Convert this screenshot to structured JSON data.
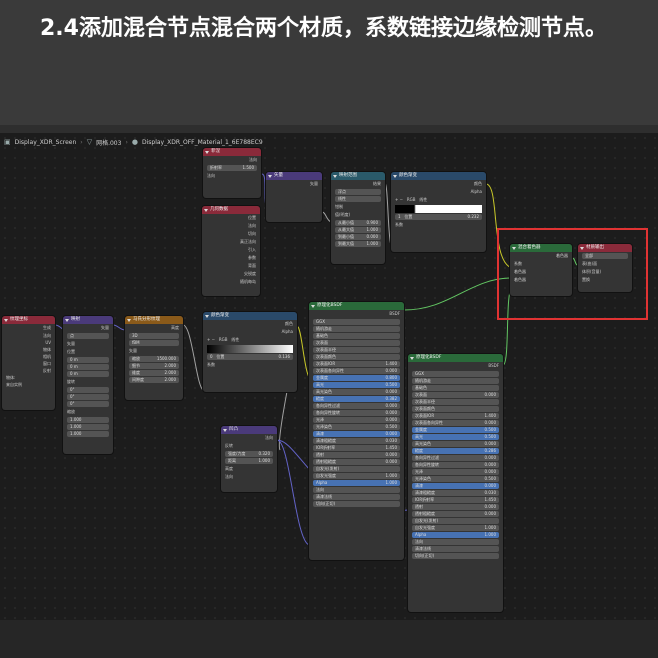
{
  "title": "2.4添加混合节点混合两个材质，系数链接边缘检测节点。",
  "breadcrumb": {
    "screen": "Display_XDR_Screen",
    "mesh": "网格.003",
    "material": "Display_XDR_OFF_Material_1_6E788EC9"
  },
  "nodes": {
    "texcoord": {
      "title": "纹理坐标",
      "rows": [
        "生成",
        "法向",
        "UV",
        "物体",
        "相机",
        "窗口",
        "反射"
      ],
      "object_label": "物体:",
      "from_instancer": "来自实例"
    },
    "mapping": {
      "title": "映射",
      "vector": "矢量",
      "type_label": "类型:",
      "type_value": "点",
      "vec_label": "矢量",
      "location": "位置",
      "rotation": "旋转",
      "scale": "缩放",
      "x": "X",
      "y": "Y",
      "z": "Z",
      "loc_vals": [
        "0 m",
        "0 m",
        "0 m"
      ],
      "rot_vals": [
        "0°",
        "0°",
        "0°"
      ],
      "scale_vals": [
        "1.000",
        "1.000",
        "1.000"
      ]
    },
    "musgrave": {
      "title": "马氏分形纹理",
      "height": "高度",
      "dim": "3D",
      "type": "fBM",
      "vec": "矢量",
      "rows": [
        [
          "缩放",
          "1500.000"
        ],
        [
          "细节",
          "2.000"
        ],
        [
          "维度",
          "2.000"
        ],
        [
          "间隙度",
          "2.000"
        ]
      ]
    },
    "colorramp1": {
      "title": "颜色渐变",
      "color": "颜色",
      "alpha": "Alpha",
      "mode": "RGB",
      "interp": "线性",
      "index": "0",
      "pos_label": "位置",
      "pos": "0.136",
      "fac": "系数"
    },
    "bump": {
      "title": "凹凸",
      "normal": "法向",
      "invert": "反转",
      "rows": [
        [
          "强度/力度",
          "0.320"
        ],
        [
          "距离",
          "1.000"
        ]
      ],
      "height": "高度",
      "normal_in": "法向"
    },
    "geometry_small": {
      "title": "菲涅",
      "out": "法向",
      "fields": [
        "折射率",
        "1.500"
      ],
      "normal": "法向"
    },
    "vector": {
      "title": "矢量",
      "out": "矢量"
    },
    "layer_weight": {
      "title": "几何数据",
      "rows": [
        "位置",
        "法向",
        "切向",
        "真正法向",
        "引入",
        "参数",
        "背面",
        "尖锐度",
        "随机每岛"
      ]
    },
    "math": {
      "title": "颜色渐变",
      "out_color": "颜色",
      "out_alpha": "Alpha",
      "mode": "RGB",
      "interp": "线性",
      "index": "1",
      "pos_label": "位置",
      "pos": "0.232",
      "fac": "系数"
    },
    "math2": {
      "title": "映射范围",
      "out": "结果",
      "type": "浮点",
      "interp": "线性",
      "clamp": "钳制",
      "value_label": "值(明度)",
      "rows": [
        [
          "从最小值",
          "0.900"
        ],
        [
          "从最大值",
          "1.000"
        ],
        [
          "到最小值",
          "0.000"
        ],
        [
          "到最大值",
          "1.000"
        ]
      ]
    },
    "mix_shader": {
      "title": "混合着色器",
      "out": "着色器",
      "fac": "系数",
      "shader1": "着色器",
      "shader2": "着色器"
    },
    "output": {
      "title": "材质输出",
      "target": "全部",
      "surface": "表(曲)面",
      "volume": "体积(音量)",
      "displacement": "置换"
    },
    "bsdf1": {
      "title": "原理化BSDF",
      "out": "BSDF",
      "dist": "GGX",
      "sss": "随机游走",
      "rows": [
        [
          "基础色",
          ""
        ],
        [
          "次表面",
          ""
        ],
        [
          "次表面半径",
          ""
        ],
        [
          "次表面颜色",
          ""
        ],
        [
          "次表面IOR",
          "1.400"
        ],
        [
          "次表面各向异性",
          "0.000"
        ],
        [
          "金属度",
          "0.800"
        ],
        [
          "高光",
          "0.500"
        ],
        [
          "高光染色",
          "0.000"
        ],
        [
          "糙度",
          "0.382"
        ],
        [
          "各向异性过滤",
          "0.000"
        ],
        [
          "各向异性旋转",
          "0.000"
        ],
        [
          "光泽",
          "0.000"
        ],
        [
          "光泽染色",
          "0.500"
        ],
        [
          "清漆",
          "0.000"
        ],
        [
          "清漆粗糙度",
          "0.030"
        ],
        [
          "IOR折射率",
          "1.450"
        ],
        [
          "透射",
          "0.000"
        ],
        [
          "透射粗糙度",
          "0.000"
        ],
        [
          "自发光(发射)",
          ""
        ],
        [
          "自发光强度",
          "1.000"
        ],
        [
          "Alpha",
          "1.000"
        ],
        [
          "法向",
          ""
        ],
        [
          "清漆法线",
          ""
        ],
        [
          "切向(正切)",
          ""
        ]
      ]
    },
    "bsdf2": {
      "title": "原理化BSDF",
      "out": "BSDF",
      "dist": "GGX",
      "sss": "随机游走",
      "rows": [
        [
          "基础色",
          ""
        ],
        [
          "次表面",
          "0.000"
        ],
        [
          "次表面半径",
          ""
        ],
        [
          "次表面颜色",
          ""
        ],
        [
          "次表面IOR",
          "1.400"
        ],
        [
          "次表面各向异性",
          "0.000"
        ],
        [
          "金属度",
          "0.500"
        ],
        [
          "高光",
          "0.500"
        ],
        [
          "高光染色",
          "0.000"
        ],
        [
          "糙度",
          "0.286"
        ],
        [
          "各向异性过滤",
          "0.000"
        ],
        [
          "各向异性旋转",
          "0.000"
        ],
        [
          "光泽",
          "0.000"
        ],
        [
          "光泽染色",
          "0.500"
        ],
        [
          "清漆",
          "0.000"
        ],
        [
          "清漆粗糙度",
          "0.030"
        ],
        [
          "IOR折射率",
          "1.450"
        ],
        [
          "透射",
          "0.000"
        ],
        [
          "透射粗糙度",
          "0.000"
        ],
        [
          "自发光(发射)",
          ""
        ],
        [
          "自发光强度",
          "1.000"
        ],
        [
          "Alpha",
          "1.000"
        ],
        [
          "法向",
          ""
        ],
        [
          "清漆法线",
          ""
        ],
        [
          "切向(正切)",
          ""
        ]
      ]
    }
  }
}
